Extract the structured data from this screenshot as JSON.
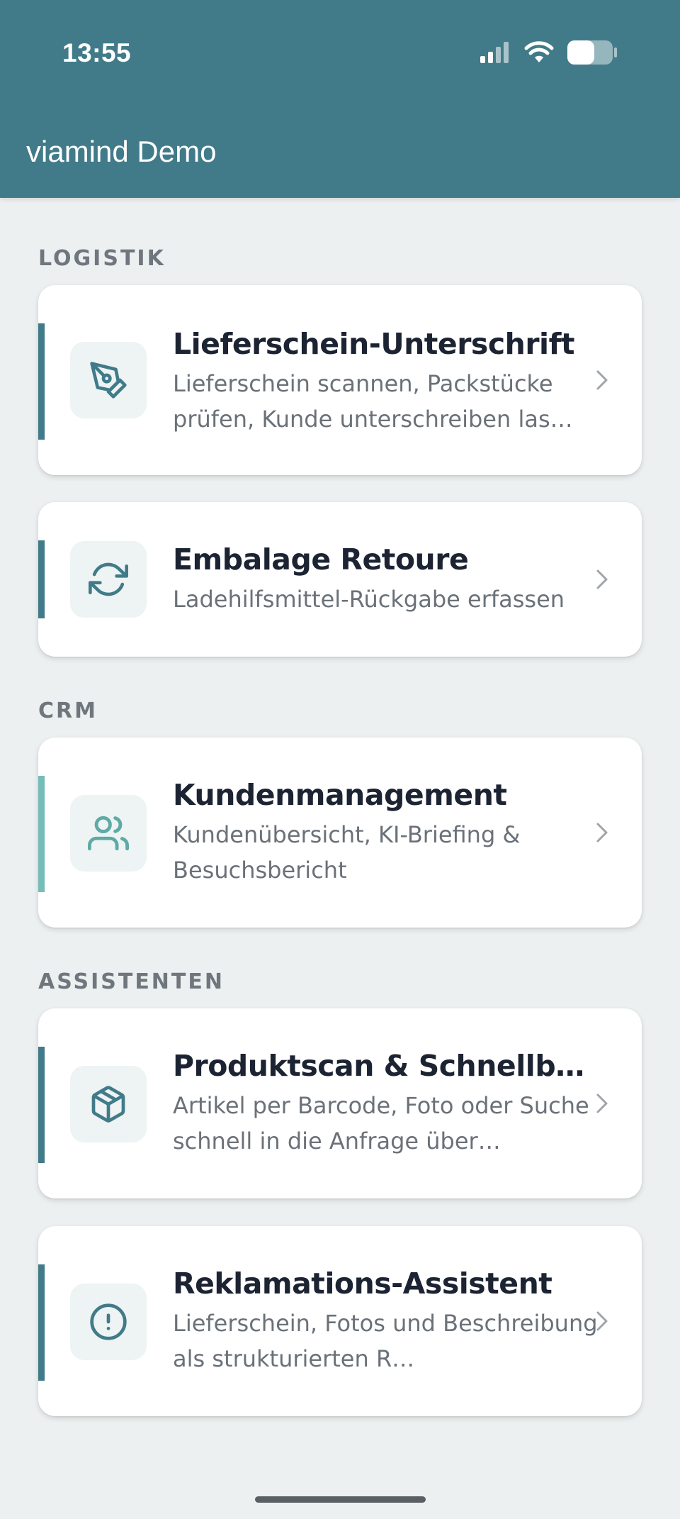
{
  "status_bar": {
    "time": "13:55",
    "signal_icon": "cellular-signal-icon",
    "wifi_icon": "wifi-icon",
    "battery_icon": "battery-icon"
  },
  "app_bar": {
    "title": "viamind Demo"
  },
  "sections": {
    "logistik": {
      "label": "LOGISTIK",
      "items": [
        {
          "title": "Lieferschein-Unterschrift",
          "description": "Lieferschein scannen, Packstücke prüfen, Kunde unterschreiben las…",
          "icon": "pen-tool-icon"
        },
        {
          "title": "Embalage Retoure",
          "description": "Ladehilfsmittel-Rückgabe erfassen",
          "icon": "refresh-icon"
        }
      ]
    },
    "crm": {
      "label": "CRM",
      "items": [
        {
          "title": "Kundenmanagement",
          "description": "Kundenübersicht, KI-Briefing & Besuchsbericht",
          "icon": "users-icon"
        }
      ]
    },
    "assistenten": {
      "label": "ASSISTENTEN",
      "items": [
        {
          "title": "Produktscan & Schnellbest…",
          "description": "Artikel per Barcode, Foto oder Suche schnell in die Anfrage über…",
          "icon": "package-icon"
        },
        {
          "title": "Reklamations-Assistent",
          "description": "Lieferschein, Fotos und Beschreibung als strukturierten R…",
          "icon": "alert-circle-icon"
        }
      ]
    }
  },
  "colors": {
    "primary": "#417b89",
    "accent_light": "#76bcb8",
    "background": "#ecf0f0",
    "card": "#ffffff",
    "title_text": "#1c2332",
    "secondary_text": "#6b7178"
  }
}
